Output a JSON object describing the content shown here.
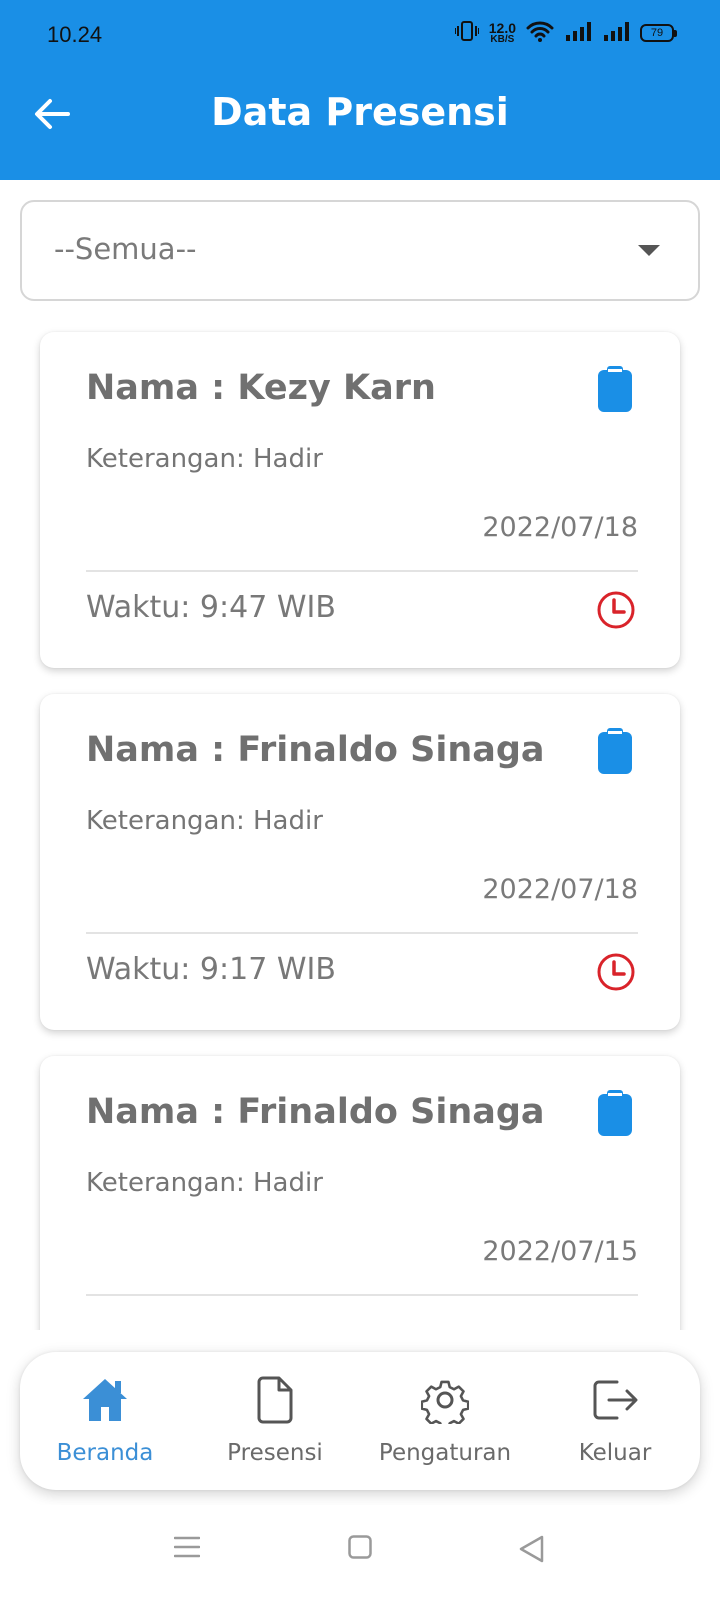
{
  "status_bar": {
    "time": "10.24",
    "net_speed_value": "12.0",
    "net_speed_unit": "KB/S",
    "battery": "79"
  },
  "header": {
    "title": "Data Presensi",
    "back_icon": "arrow-left-icon",
    "background_color": "#1a8fe6"
  },
  "filter": {
    "selected": "--Semua--"
  },
  "cards": [
    {
      "name": "Nama : Kezy Karn",
      "keterangan": "Keterangan: Hadir",
      "date": "2022/07/18",
      "waktu": "Waktu: 9:47 WIB"
    },
    {
      "name": "Nama : Frinaldo Sinaga",
      "keterangan": "Keterangan: Hadir",
      "date": "2022/07/18",
      "waktu": "Waktu: 9:17 WIB"
    },
    {
      "name": "Nama : Frinaldo Sinaga",
      "keterangan": "Keterangan: Hadir",
      "date": "2022/07/15",
      "waktu": ""
    }
  ],
  "bottom_nav": {
    "items": [
      {
        "label": "Beranda",
        "icon": "home-icon",
        "active": true
      },
      {
        "label": "Presensi",
        "icon": "document-icon",
        "active": false
      },
      {
        "label": "Pengaturan",
        "icon": "gear-icon",
        "active": false
      },
      {
        "label": "Keluar",
        "icon": "logout-icon",
        "active": false
      }
    ]
  },
  "colors": {
    "accent": "#1a8fe6",
    "clock": "#d9232a",
    "active_nav": "#3b8fd6"
  }
}
